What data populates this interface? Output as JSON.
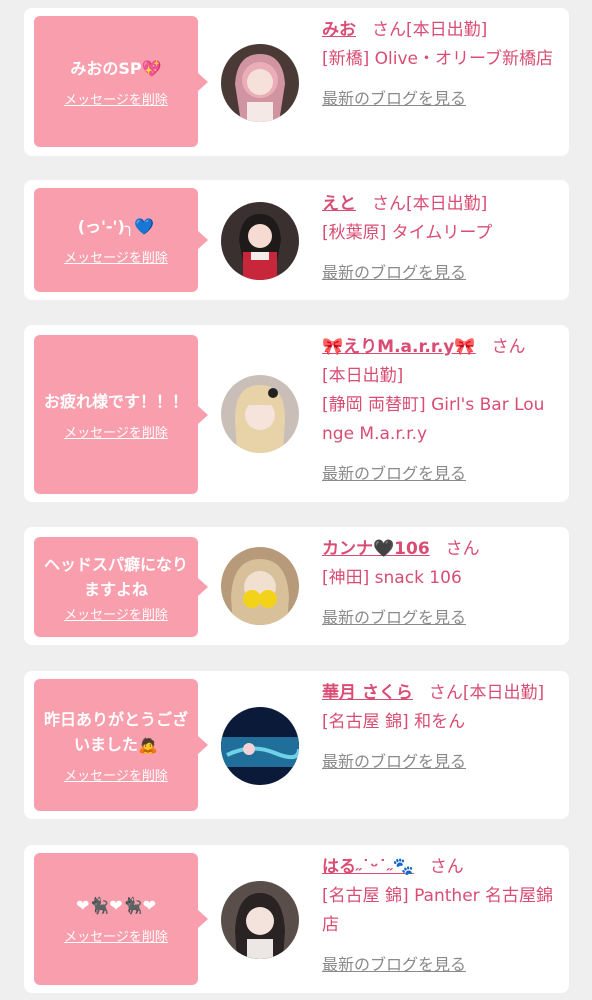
{
  "delete_label": "メッセージを削除",
  "blog_label": "最新のブログを見る",
  "san": "さん",
  "cards": [
    {
      "message": "みおのSP💖",
      "name": "みお",
      "status": "[本日出勤]",
      "shop": "[新橋] Olive・オリーブ新橋店"
    },
    {
      "message": "(っ'-')╮💙",
      "name": "えと",
      "status": "[本日出勤]",
      "shop": "[秋葉原] タイムリープ"
    },
    {
      "message": "お疲れ様です！！！",
      "name": "🎀えりM.a.r.r.y🎀",
      "status": "[本日出勤]",
      "shop": "[静岡 両替町] Girl's Bar Lounge M.a.r.r.y"
    },
    {
      "message": "ヘッドスパ癖になりますよね",
      "name": "カンナ🖤106",
      "status": "",
      "shop": "[神田] snack 106"
    },
    {
      "message": "昨日ありがとうございました🙇",
      "name": "華月 さくら",
      "status": "[本日出勤]",
      "shop": "[名古屋 錦] 和をん"
    },
    {
      "message": "❤🐈‍⬛❤🐈‍⬛❤",
      "name": "はる˶˙ᵕ˙˶🐾",
      "status": "",
      "shop": "[名古屋 錦] Panther 名古屋錦店"
    }
  ]
}
